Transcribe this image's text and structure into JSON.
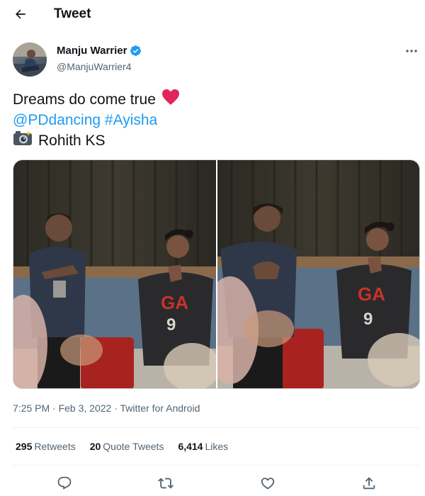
{
  "header": {
    "title": "Tweet"
  },
  "author": {
    "name": "Manju Warrier",
    "handle": "@ManjuWarrier4",
    "verified": true
  },
  "tweet": {
    "line1": "Dreams do come true",
    "mention": "@PDdancing",
    "hashtag": "#Ayisha",
    "credit": "Rohith KS",
    "emoji_heart": "❤️",
    "emoji_camera": "📸"
  },
  "meta": {
    "time": "7:25 PM",
    "separator1": " · ",
    "date": "Feb 3, 2022",
    "separator2": " · ",
    "source": "Twitter for Android"
  },
  "stats": {
    "retweets_count": "295",
    "retweets_label": "Retweets",
    "quotes_count": "20",
    "quotes_label": "Quote Tweets",
    "likes_count": "6,414",
    "likes_label": "Likes"
  },
  "colors": {
    "link": "#1d9bf0",
    "verified": "#1d9bf0",
    "text_primary": "#0f1419",
    "text_secondary": "#536471",
    "heart": "#e0245e"
  },
  "icons": {
    "back": "arrow-left-icon",
    "verified": "verified-badge-icon",
    "more": "more-horizontal-icon",
    "reply": "reply-icon",
    "retweet": "retweet-icon",
    "like": "like-icon",
    "share": "share-icon"
  }
}
